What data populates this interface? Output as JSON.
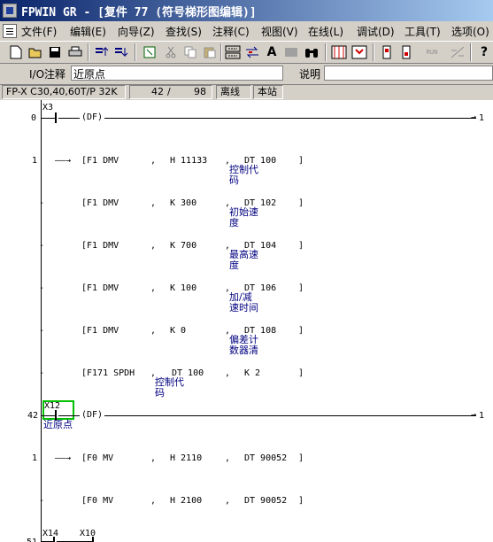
{
  "window": {
    "title": "FPWIN GR - [复件 77 (符号梯形图编辑)]"
  },
  "menu": [
    {
      "label": "文件(F)"
    },
    {
      "label": "编辑(E)"
    },
    {
      "label": "向导(Z)"
    },
    {
      "label": "查找(S)"
    },
    {
      "label": "注释(C)"
    },
    {
      "label": "视图(V)"
    },
    {
      "label": "在线(L)"
    },
    {
      "label": "调试(D)"
    },
    {
      "label": "工具(T)"
    },
    {
      "label": "选项(O)"
    }
  ],
  "toolbar": {
    "items": [
      "new-icon",
      "open-icon",
      "save-icon",
      "print-icon",
      "program-up-icon",
      "program-down-icon",
      "find-icon",
      "cut-icon",
      "copy-icon",
      "paste-icon",
      "insert-row-icon",
      "replace-icon",
      "text-icon",
      "block-icon",
      "binoculars-icon",
      "monitor-icon",
      "message-icon",
      "plc-read-icon",
      "plc-write-icon",
      "run-icon",
      "stop-icon",
      "help-icon"
    ],
    "run_label": "RUN",
    "text_glyph": "A",
    "help_glyph": "?"
  },
  "comment_bar": {
    "io_label": "I/O注释",
    "io_value": "近原点",
    "desc_label": "说明",
    "desc_value": ""
  },
  "status": {
    "plc_model": "FP-X C30,40,60T/P 32K",
    "step_current": "42",
    "step_sep": "/",
    "step_total": "98",
    "mode": "离线",
    "station": "本站"
  },
  "ladder": {
    "rung1": {
      "step": "0",
      "contact": "X3",
      "instr": "(DF)",
      "end_mark": "1"
    },
    "rows": [
      {
        "step": "1",
        "arrow": "——→",
        "instr": "[F1 DMV",
        "comma1": ",",
        "op1": "H 11133",
        "comma2": ",",
        "op2": "DT 100",
        "close": "]",
        "comment": [
          "控制代",
          "码"
        ]
      },
      {
        "instr": "[F1 DMV",
        "comma1": ",",
        "op1": "K 300",
        "comma2": ",",
        "op2": "DT 102",
        "close": "]",
        "comment": [
          "初始速",
          "度"
        ]
      },
      {
        "instr": "[F1 DMV",
        "comma1": ",",
        "op1": "K 700",
        "comma2": ",",
        "op2": "DT 104",
        "close": "]",
        "comment": [
          "最高速",
          "度"
        ]
      },
      {
        "instr": "[F1 DMV",
        "comma1": ",",
        "op1": "K 100",
        "comma2": ",",
        "op2": "DT 106",
        "close": "]",
        "comment": [
          "加/减",
          "速时间"
        ]
      },
      {
        "instr": "[F1 DMV",
        "comma1": ",",
        "op1": "K 0",
        "comma2": ",",
        "op2": "DT 108",
        "close": "]",
        "comment": [
          "偏差计",
          "数器清"
        ]
      },
      {
        "instr": "[F171 SPDH",
        "comma1": ",",
        "op1": "DT 100",
        "comma2": ",",
        "op2": "K 2",
        "close": "]",
        "comment": [
          "控制代",
          "码"
        ]
      }
    ],
    "rung2": {
      "step": "42",
      "contact": "X12",
      "contact_comment": "近原点",
      "instr": "(DF)",
      "end_mark": "1"
    },
    "rows2": [
      {
        "step": "1",
        "arrow": "——→",
        "instr": "[F0 MV",
        "comma1": ",",
        "op1": "H 2110",
        "comma2": ",",
        "op2": "DT 90052",
        "close": "]"
      },
      {
        "instr": "[F0 MV",
        "comma1": ",",
        "op1": "H 2100",
        "comma2": ",",
        "op2": "DT 90052",
        "close": "]"
      }
    ],
    "rung3": {
      "step": "51",
      "contact_a": "X14",
      "contact_b": "X10"
    }
  }
}
